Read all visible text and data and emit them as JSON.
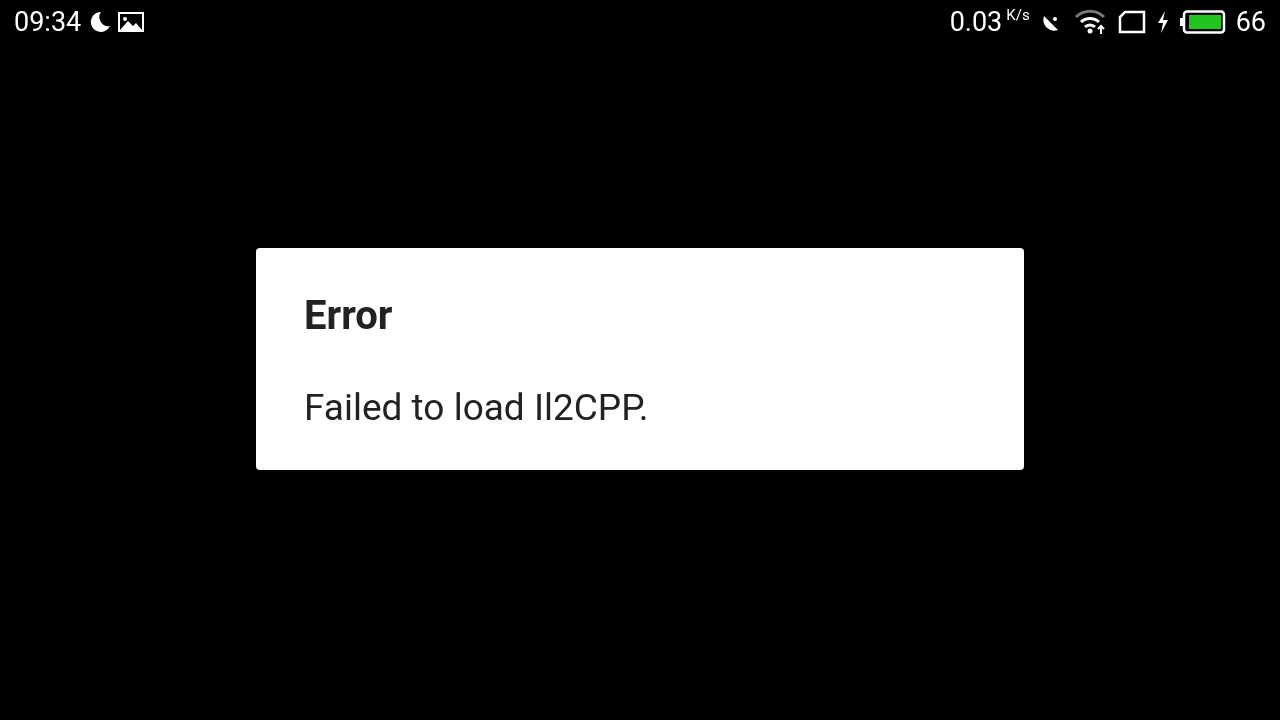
{
  "status_bar": {
    "time": "09:34",
    "speed": "0.03",
    "speed_unit": "K/s",
    "battery_percent": "66"
  },
  "dialog": {
    "title": "Error",
    "message": "Failed to load Il2CPP."
  }
}
